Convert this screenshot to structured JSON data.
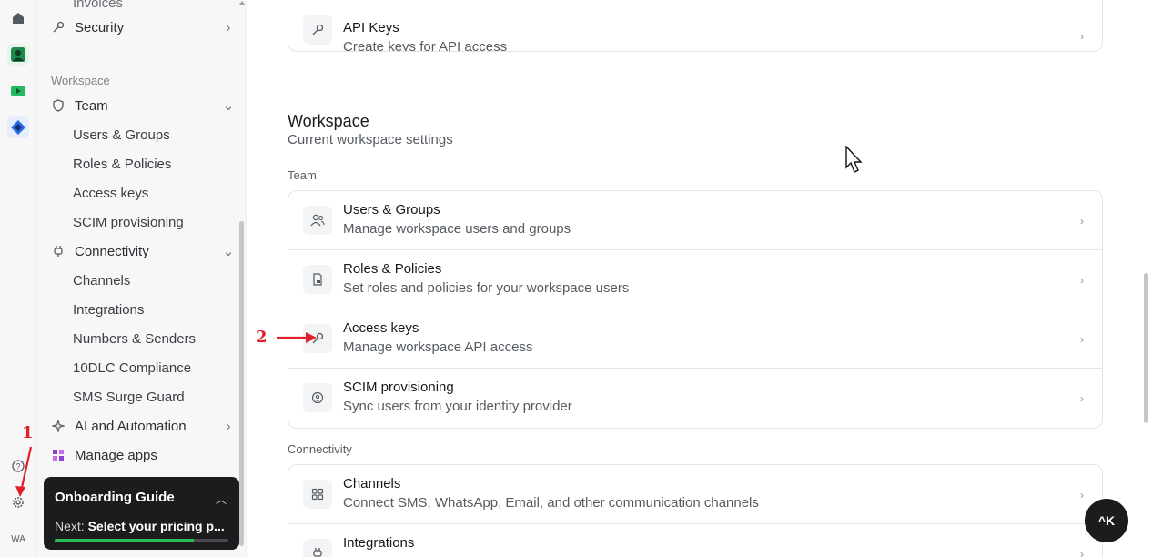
{
  "rail": {
    "avatar_initials": "WA"
  },
  "sidebar": {
    "top_partial": "Invoices",
    "security": "Security",
    "workspace_label": "Workspace",
    "team": "Team",
    "team_items": [
      "Users & Groups",
      "Roles & Policies",
      "Access keys",
      "SCIM provisioning"
    ],
    "connectivity": "Connectivity",
    "connectivity_items": [
      "Channels",
      "Integrations",
      "Numbers & Senders",
      "10DLC Compliance",
      "SMS Surge Guard"
    ],
    "ai": "AI and Automation",
    "manage_apps": "Manage apps"
  },
  "onboarding": {
    "title": "Onboarding Guide",
    "next_prefix": "Next:",
    "next_text": "Select your pricing p...",
    "progress": 0.8
  },
  "main": {
    "api_keys": {
      "title": "API Keys",
      "desc": "Create keys for API access"
    },
    "workspace_title": "Workspace",
    "workspace_sub": "Current workspace settings",
    "team_label": "Team",
    "team_items": [
      {
        "title": "Users & Groups",
        "desc": "Manage workspace users and groups"
      },
      {
        "title": "Roles & Policies",
        "desc": "Set roles and policies for your workspace users"
      },
      {
        "title": "Access keys",
        "desc": "Manage workspace API access"
      },
      {
        "title": "SCIM provisioning",
        "desc": "Sync users from your identity provider"
      }
    ],
    "connectivity_label": "Connectivity",
    "connectivity_items": [
      {
        "title": "Channels",
        "desc": "Connect SMS, WhatsApp, Email, and other communication channels"
      },
      {
        "title": "Integrations",
        "desc": ""
      }
    ]
  },
  "shortcut_button": "^K",
  "annotations": {
    "one": "1",
    "two": "2"
  },
  "colors": {
    "progress": "#2bbf5a",
    "annotation": "#e0202a",
    "dark": "#1c1c1f"
  }
}
